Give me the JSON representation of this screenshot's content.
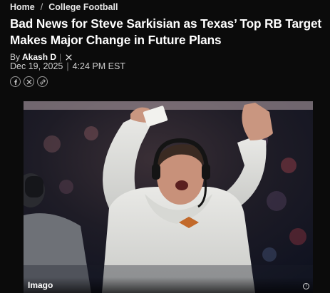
{
  "breadcrumb": {
    "home": "Home",
    "separator": "/",
    "section": "College Football"
  },
  "article": {
    "headline": "Bad News for Steve Sarkisian as Texas’ Top RB Target Makes Major Change in Future Plans",
    "byline_prefix": "By",
    "author": "Akash D",
    "date": "Dec 19, 2025",
    "time": "4:24 PM EST"
  },
  "share": {
    "icons": [
      "facebook-icon",
      "x-icon",
      "link-icon"
    ]
  },
  "hero": {
    "credit": "Imago",
    "info_glyph": "i"
  },
  "colors": {
    "background": "#0b0b0b",
    "text": "#ffffff",
    "muted": "#cfcfcf"
  }
}
